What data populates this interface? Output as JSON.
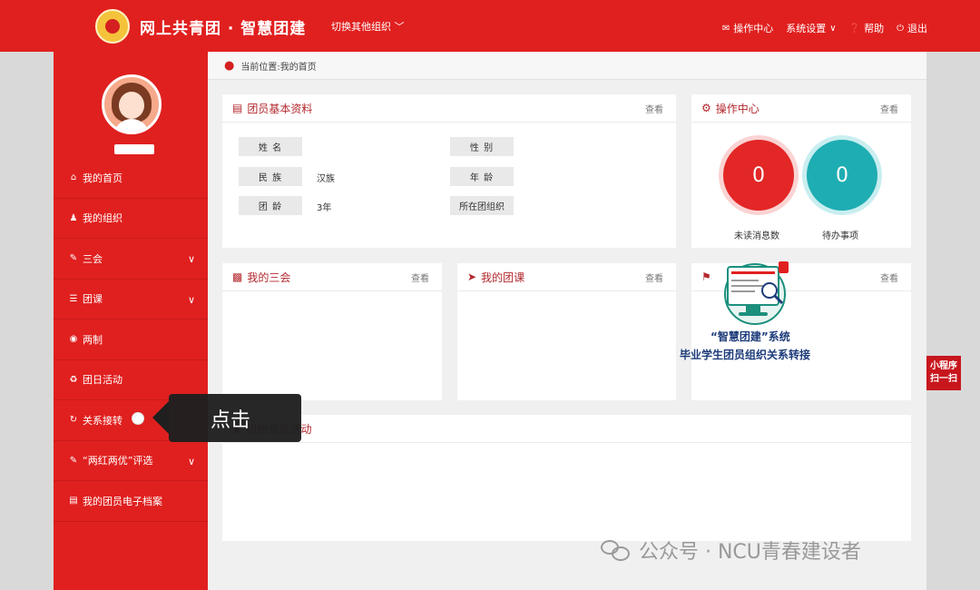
{
  "header": {
    "brand": "网上共青团 · 智慧团建",
    "switch_org": "切换其他组织",
    "nav": [
      {
        "icon": "envelope-icon",
        "label": "操作中心"
      },
      {
        "icon": "chevron-down-icon",
        "label": "系统设置"
      },
      {
        "icon": "help-icon",
        "label": "帮助"
      },
      {
        "icon": "power-icon",
        "label": "退出"
      }
    ]
  },
  "sidebar": {
    "items": [
      {
        "label": "我的首页",
        "icon": "home-icon",
        "expand": false
      },
      {
        "label": "我的组织",
        "icon": "users-icon",
        "expand": false
      },
      {
        "label": "三会",
        "icon": "edit-icon",
        "expand": true
      },
      {
        "label": "团课",
        "icon": "folder-icon",
        "expand": true
      },
      {
        "label": "两制",
        "icon": "circle-icon",
        "expand": false
      },
      {
        "label": "团日活动",
        "icon": "recycle-icon",
        "expand": false
      },
      {
        "label": "关系接转",
        "icon": "refresh-icon",
        "expand": false
      },
      {
        "label": "“两红两优”评选",
        "icon": "edit-icon",
        "expand": true
      },
      {
        "label": "我的团员电子档案",
        "icon": "file-icon",
        "expand": false
      }
    ]
  },
  "breadcrumb": "当前位置:我的首页",
  "basic_info": {
    "title": "团员基本资料",
    "more": "查看",
    "fields": [
      {
        "label": "姓 名",
        "value": ""
      },
      {
        "label": "性 别",
        "value": ""
      },
      {
        "label": "民 族",
        "value": "汉族"
      },
      {
        "label": "年 龄",
        "value": ""
      },
      {
        "label": "团 龄",
        "value": "3年"
      },
      {
        "label": "所在团组织",
        "value": ""
      }
    ]
  },
  "ops_center": {
    "title": "操作中心",
    "more": "查看",
    "unread": {
      "value": "0",
      "label": "未读消息数"
    },
    "todo": {
      "value": "0",
      "label": "待办事项"
    }
  },
  "sanhui": {
    "title": "我的三会",
    "more": "查看"
  },
  "course": {
    "title": "我的团课",
    "more": "查看"
  },
  "third": {
    "more": "查看"
  },
  "meeting": {
    "title": "组织会议活动"
  },
  "overlay": {
    "line1": "“智慧团建”系统",
    "line2": "毕业学生团员组织关系转接"
  },
  "mini_program": {
    "line1": "小程序",
    "line2": "扫一扫"
  },
  "callout": {
    "text": "点击"
  },
  "watermark": "公众号 · NCU青春建设者",
  "colors": {
    "primary": "#e0201f",
    "title": "#b3282d",
    "unread": "#e32626",
    "todo": "#1eadb2"
  }
}
